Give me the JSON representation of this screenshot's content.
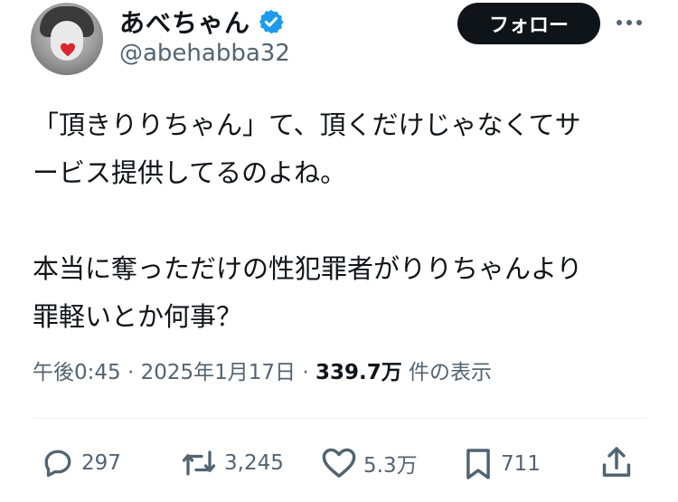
{
  "user": {
    "display_name": "あべちゃん",
    "handle": "@abehabba32",
    "verified_color": "#1d9bf0"
  },
  "follow_label": "フォロー",
  "tweet": {
    "lines": [
      "「頂きりりちゃん」て、頂くだけじゃなくてサ",
      "ービス提供してるのよね。",
      "",
      "本当に奪っただけの性犯罪者がりりちゃんより",
      "罪軽いとか何事？"
    ]
  },
  "meta": {
    "time": "午後0:45",
    "sep1": " · ",
    "date": "2025年1月17日",
    "sep2": " · ",
    "views_count": "339.7万",
    "views_label": " 件の表示"
  },
  "actions": {
    "replies": "297",
    "reposts": "3,245",
    "likes": "5.3万",
    "bookmarks": "711"
  },
  "icons": [
    "more-icon",
    "reply-icon",
    "repost-icon",
    "like-icon",
    "bookmark-icon",
    "share-icon",
    "verified-badge-icon"
  ]
}
